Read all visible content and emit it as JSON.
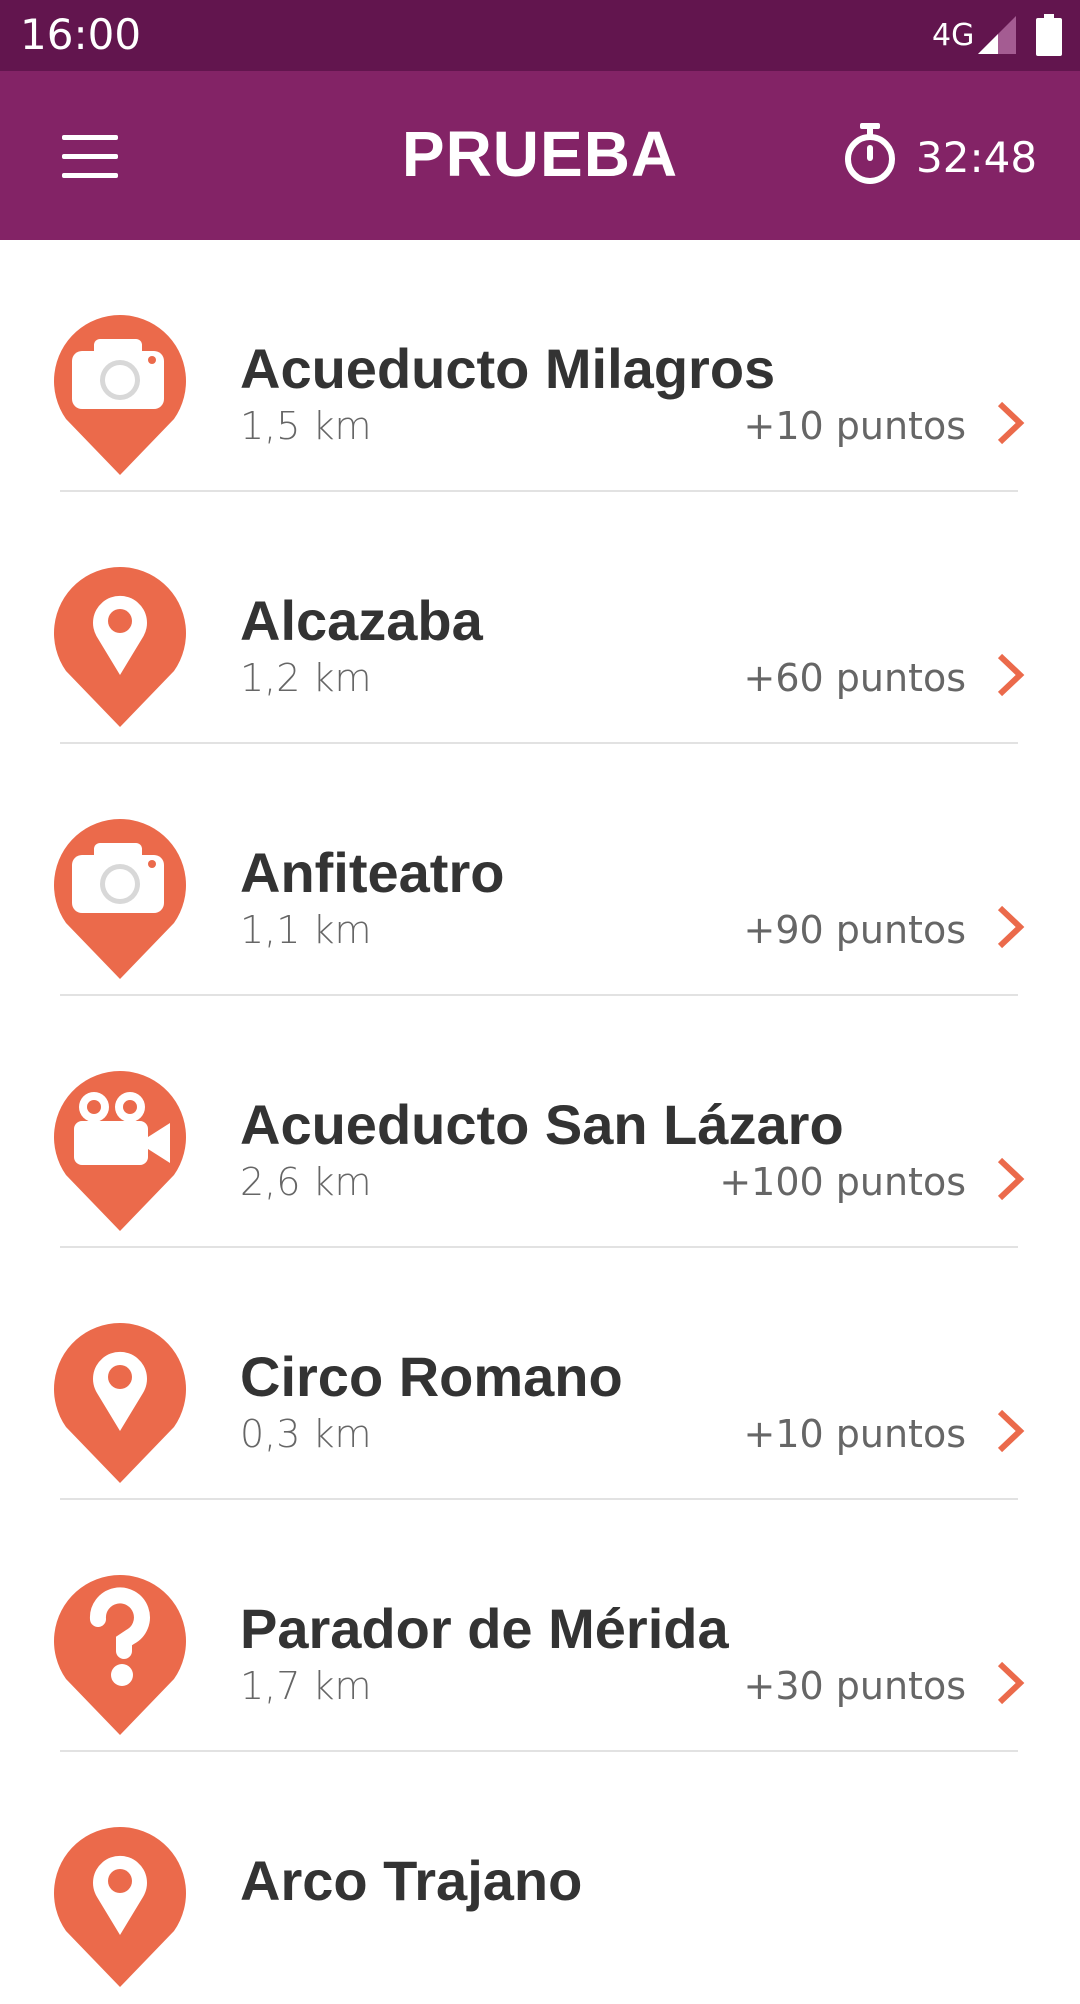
{
  "status_bar": {
    "time": "16:00",
    "network": "4G",
    "icons": [
      "signal-icon",
      "battery-icon"
    ]
  },
  "app_bar": {
    "title": "PRUEBA",
    "timer": "32:48",
    "icons": [
      "menu-icon",
      "stopwatch-icon"
    ]
  },
  "colors": {
    "status_bar": "#62154e",
    "app_bar": "#832366",
    "accent": "#eb6a4b"
  },
  "items": [
    {
      "name": "Acueducto Milagros",
      "distance": "1,5 km",
      "points": "+10 puntos",
      "icon": "camera-pin-icon"
    },
    {
      "name": "Alcazaba",
      "distance": "1,2 km",
      "points": "+60 puntos",
      "icon": "location-pin-icon"
    },
    {
      "name": "Anfiteatro",
      "distance": "1,1 km",
      "points": "+90 puntos",
      "icon": "camera-pin-icon"
    },
    {
      "name": "Acueducto San Lázaro",
      "distance": "2,6 km",
      "points": "+100 puntos",
      "icon": "video-camera-pin-icon"
    },
    {
      "name": "Circo Romano",
      "distance": "0,3 km",
      "points": "+10 puntos",
      "icon": "location-pin-icon"
    },
    {
      "name": "Parador de Mérida",
      "distance": "1,7 km",
      "points": "+30 puntos",
      "icon": "question-pin-icon"
    },
    {
      "name": "Arco Trajano",
      "distance": "",
      "points": "",
      "icon": "location-pin-icon"
    }
  ]
}
